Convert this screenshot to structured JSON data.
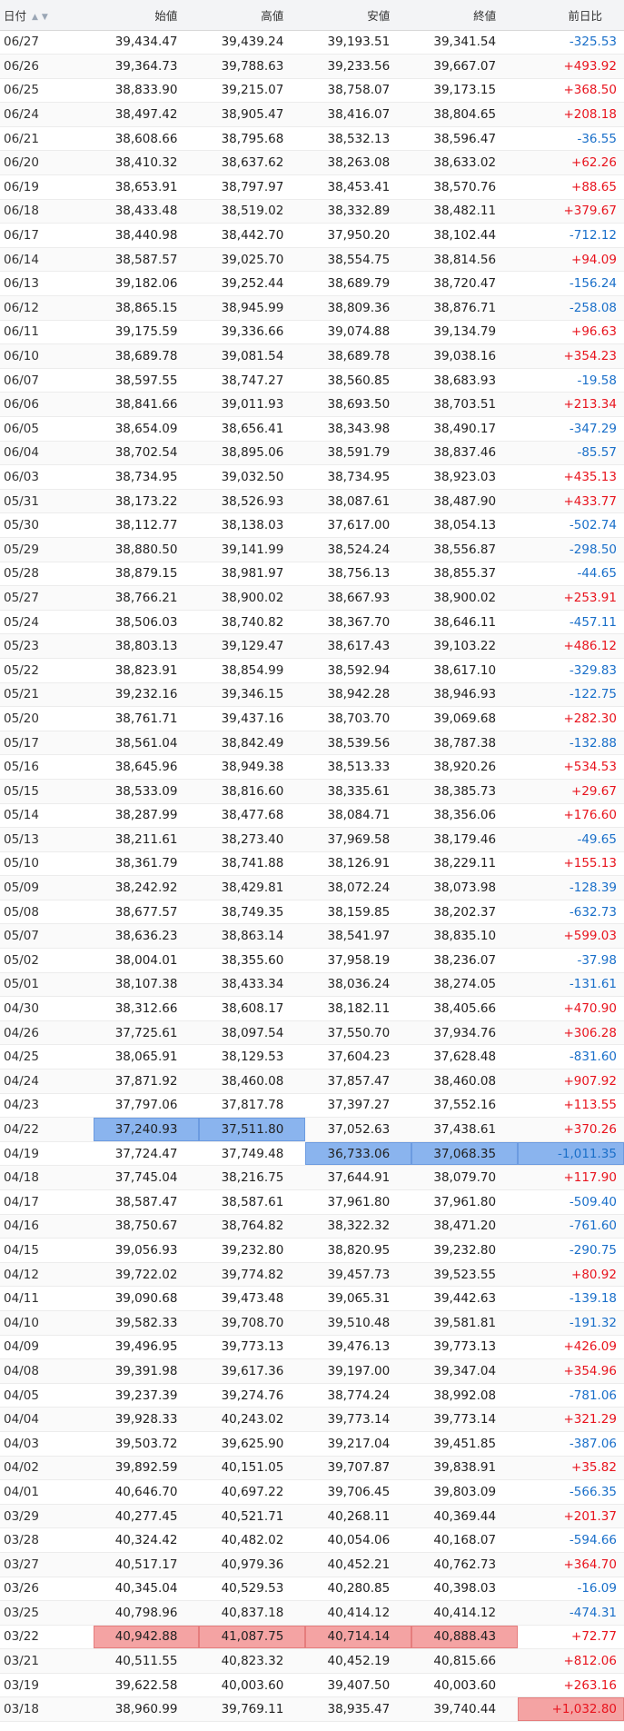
{
  "table": {
    "headers": {
      "date": "日付",
      "open": "始値",
      "high": "高値",
      "low": "安値",
      "close": "終値",
      "change": "前日比"
    },
    "sort_icon": "sort-up-down-icon",
    "colors": {
      "positive": "#e8141e",
      "negative": "#1a6fc9",
      "highlight_blue": "#8ab4ee",
      "highlight_red": "#f4a3a3"
    },
    "rows": [
      [
        "06/27",
        "39,434.47",
        "39,439.24",
        "39,193.51",
        "39,341.54",
        "-325.53"
      ],
      [
        "06/26",
        "39,364.73",
        "39,788.63",
        "39,233.56",
        "39,667.07",
        "+493.92"
      ],
      [
        "06/25",
        "38,833.90",
        "39,215.07",
        "38,758.07",
        "39,173.15",
        "+368.50"
      ],
      [
        "06/24",
        "38,497.42",
        "38,905.47",
        "38,416.07",
        "38,804.65",
        "+208.18"
      ],
      [
        "06/21",
        "38,608.66",
        "38,795.68",
        "38,532.13",
        "38,596.47",
        "-36.55"
      ],
      [
        "06/20",
        "38,410.32",
        "38,637.62",
        "38,263.08",
        "38,633.02",
        "+62.26"
      ],
      [
        "06/19",
        "38,653.91",
        "38,797.97",
        "38,453.41",
        "38,570.76",
        "+88.65"
      ],
      [
        "06/18",
        "38,433.48",
        "38,519.02",
        "38,332.89",
        "38,482.11",
        "+379.67"
      ],
      [
        "06/17",
        "38,440.98",
        "38,442.70",
        "37,950.20",
        "38,102.44",
        "-712.12"
      ],
      [
        "06/14",
        "38,587.57",
        "39,025.70",
        "38,554.75",
        "38,814.56",
        "+94.09"
      ],
      [
        "06/13",
        "39,182.06",
        "39,252.44",
        "38,689.79",
        "38,720.47",
        "-156.24"
      ],
      [
        "06/12",
        "38,865.15",
        "38,945.99",
        "38,809.36",
        "38,876.71",
        "-258.08"
      ],
      [
        "06/11",
        "39,175.59",
        "39,336.66",
        "39,074.88",
        "39,134.79",
        "+96.63"
      ],
      [
        "06/10",
        "38,689.78",
        "39,081.54",
        "38,689.78",
        "39,038.16",
        "+354.23"
      ],
      [
        "06/07",
        "38,597.55",
        "38,747.27",
        "38,560.85",
        "38,683.93",
        "-19.58"
      ],
      [
        "06/06",
        "38,841.66",
        "39,011.93",
        "38,693.50",
        "38,703.51",
        "+213.34"
      ],
      [
        "06/05",
        "38,654.09",
        "38,656.41",
        "38,343.98",
        "38,490.17",
        "-347.29"
      ],
      [
        "06/04",
        "38,702.54",
        "38,895.06",
        "38,591.79",
        "38,837.46",
        "-85.57"
      ],
      [
        "06/03",
        "38,734.95",
        "39,032.50",
        "38,734.95",
        "38,923.03",
        "+435.13"
      ],
      [
        "05/31",
        "38,173.22",
        "38,526.93",
        "38,087.61",
        "38,487.90",
        "+433.77"
      ],
      [
        "05/30",
        "38,112.77",
        "38,138.03",
        "37,617.00",
        "38,054.13",
        "-502.74"
      ],
      [
        "05/29",
        "38,880.50",
        "39,141.99",
        "38,524.24",
        "38,556.87",
        "-298.50"
      ],
      [
        "05/28",
        "38,879.15",
        "38,981.97",
        "38,756.13",
        "38,855.37",
        "-44.65"
      ],
      [
        "05/27",
        "38,766.21",
        "38,900.02",
        "38,667.93",
        "38,900.02",
        "+253.91"
      ],
      [
        "05/24",
        "38,506.03",
        "38,740.82",
        "38,367.70",
        "38,646.11",
        "-457.11"
      ],
      [
        "05/23",
        "38,803.13",
        "39,129.47",
        "38,617.43",
        "39,103.22",
        "+486.12"
      ],
      [
        "05/22",
        "38,823.91",
        "38,854.99",
        "38,592.94",
        "38,617.10",
        "-329.83"
      ],
      [
        "05/21",
        "39,232.16",
        "39,346.15",
        "38,942.28",
        "38,946.93",
        "-122.75"
      ],
      [
        "05/20",
        "38,761.71",
        "39,437.16",
        "38,703.70",
        "39,069.68",
        "+282.30"
      ],
      [
        "05/17",
        "38,561.04",
        "38,842.49",
        "38,539.56",
        "38,787.38",
        "-132.88"
      ],
      [
        "05/16",
        "38,645.96",
        "38,949.38",
        "38,513.33",
        "38,920.26",
        "+534.53"
      ],
      [
        "05/15",
        "38,533.09",
        "38,816.60",
        "38,335.61",
        "38,385.73",
        "+29.67"
      ],
      [
        "05/14",
        "38,287.99",
        "38,477.68",
        "38,084.71",
        "38,356.06",
        "+176.60"
      ],
      [
        "05/13",
        "38,211.61",
        "38,273.40",
        "37,969.58",
        "38,179.46",
        "-49.65"
      ],
      [
        "05/10",
        "38,361.79",
        "38,741.88",
        "38,126.91",
        "38,229.11",
        "+155.13"
      ],
      [
        "05/09",
        "38,242.92",
        "38,429.81",
        "38,072.24",
        "38,073.98",
        "-128.39"
      ],
      [
        "05/08",
        "38,677.57",
        "38,749.35",
        "38,159.85",
        "38,202.37",
        "-632.73"
      ],
      [
        "05/07",
        "38,636.23",
        "38,863.14",
        "38,541.97",
        "38,835.10",
        "+599.03"
      ],
      [
        "05/02",
        "38,004.01",
        "38,355.60",
        "37,958.19",
        "38,236.07",
        "-37.98"
      ],
      [
        "05/01",
        "38,107.38",
        "38,433.34",
        "38,036.24",
        "38,274.05",
        "-131.61"
      ],
      [
        "04/30",
        "38,312.66",
        "38,608.17",
        "38,182.11",
        "38,405.66",
        "+470.90"
      ],
      [
        "04/26",
        "37,725.61",
        "38,097.54",
        "37,550.70",
        "37,934.76",
        "+306.28"
      ],
      [
        "04/25",
        "38,065.91",
        "38,129.53",
        "37,604.23",
        "37,628.48",
        "-831.60"
      ],
      [
        "04/24",
        "37,871.92",
        "38,460.08",
        "37,857.47",
        "38,460.08",
        "+907.92"
      ],
      [
        "04/23",
        "37,797.06",
        "37,817.78",
        "37,397.27",
        "37,552.16",
        "+113.55"
      ],
      [
        "04/22",
        "37,240.93",
        "37,511.80",
        "37,052.63",
        "37,438.61",
        "+370.26"
      ],
      [
        "04/19",
        "37,724.47",
        "37,749.48",
        "36,733.06",
        "37,068.35",
        "-1,011.35"
      ],
      [
        "04/18",
        "37,745.04",
        "38,216.75",
        "37,644.91",
        "38,079.70",
        "+117.90"
      ],
      [
        "04/17",
        "38,587.47",
        "38,587.61",
        "37,961.80",
        "37,961.80",
        "-509.40"
      ],
      [
        "04/16",
        "38,750.67",
        "38,764.82",
        "38,322.32",
        "38,471.20",
        "-761.60"
      ],
      [
        "04/15",
        "39,056.93",
        "39,232.80",
        "38,820.95",
        "39,232.80",
        "-290.75"
      ],
      [
        "04/12",
        "39,722.02",
        "39,774.82",
        "39,457.73",
        "39,523.55",
        "+80.92"
      ],
      [
        "04/11",
        "39,090.68",
        "39,473.48",
        "39,065.31",
        "39,442.63",
        "-139.18"
      ],
      [
        "04/10",
        "39,582.33",
        "39,708.70",
        "39,510.48",
        "39,581.81",
        "-191.32"
      ],
      [
        "04/09",
        "39,496.95",
        "39,773.13",
        "39,476.13",
        "39,773.13",
        "+426.09"
      ],
      [
        "04/08",
        "39,391.98",
        "39,617.36",
        "39,197.00",
        "39,347.04",
        "+354.96"
      ],
      [
        "04/05",
        "39,237.39",
        "39,274.76",
        "38,774.24",
        "38,992.08",
        "-781.06"
      ],
      [
        "04/04",
        "39,928.33",
        "40,243.02",
        "39,773.14",
        "39,773.14",
        "+321.29"
      ],
      [
        "04/03",
        "39,503.72",
        "39,625.90",
        "39,217.04",
        "39,451.85",
        "-387.06"
      ],
      [
        "04/02",
        "39,892.59",
        "40,151.05",
        "39,707.87",
        "39,838.91",
        "+35.82"
      ],
      [
        "04/01",
        "40,646.70",
        "40,697.22",
        "39,706.45",
        "39,803.09",
        "-566.35"
      ],
      [
        "03/29",
        "40,277.45",
        "40,521.71",
        "40,268.11",
        "40,369.44",
        "+201.37"
      ],
      [
        "03/28",
        "40,324.42",
        "40,482.02",
        "40,054.06",
        "40,168.07",
        "-594.66"
      ],
      [
        "03/27",
        "40,517.17",
        "40,979.36",
        "40,452.21",
        "40,762.73",
        "+364.70"
      ],
      [
        "03/26",
        "40,345.04",
        "40,529.53",
        "40,280.85",
        "40,398.03",
        "-16.09"
      ],
      [
        "03/25",
        "40,798.96",
        "40,837.18",
        "40,414.12",
        "40,414.12",
        "-474.31"
      ],
      [
        "03/22",
        "40,942.88",
        "41,087.75",
        "40,714.14",
        "40,888.43",
        "+72.77"
      ],
      [
        "03/21",
        "40,511.55",
        "40,823.32",
        "40,452.19",
        "40,815.66",
        "+812.06"
      ],
      [
        "03/19",
        "39,622.58",
        "40,003.60",
        "39,407.50",
        "40,003.60",
        "+263.16"
      ],
      [
        "03/18",
        "38,960.99",
        "39,769.11",
        "38,935.47",
        "39,740.44",
        "+1,032.80"
      ]
    ],
    "highlights": [
      {
        "row": "04/22",
        "cols": [
          1,
          2
        ],
        "color": "blue"
      },
      {
        "row": "04/19",
        "cols": [
          3,
          4,
          5
        ],
        "color": "blue"
      },
      {
        "row": "03/22",
        "cols": [
          1,
          2,
          3,
          4
        ],
        "color": "red"
      },
      {
        "row": "03/18",
        "cols": [
          5
        ],
        "color": "red"
      }
    ]
  }
}
